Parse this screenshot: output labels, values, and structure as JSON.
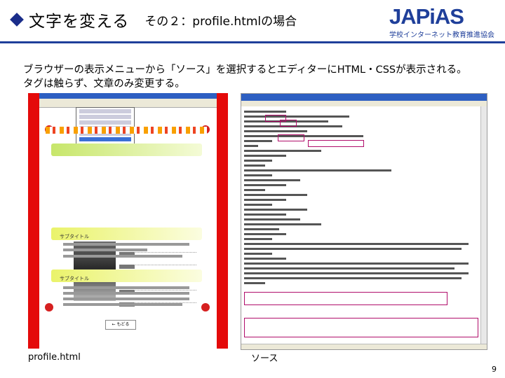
{
  "title": {
    "main": "文字を変える",
    "sub": "その２：profile.htmlの場合"
  },
  "logo": {
    "text": "JAPiAS",
    "sub": "学校インターネット教育推進協会"
  },
  "description": {
    "line1": "ブラウザーの表示メニューから「ソース」を選択するとエディターにHTML・CSSが表示される。",
    "line2": "タグは触らず、文章のみ変更する。"
  },
  "left_shot": {
    "sub_title_1": "サブタイトル",
    "sub_title_2": "サブタイトル",
    "back_label": "← もどる"
  },
  "captions": {
    "left": "profile.html",
    "right": "ソース"
  },
  "page_number": "9",
  "colors": {
    "accent": "#1f3f9a",
    "frame": "#e40a0a",
    "highlight": "#b10d6b"
  }
}
